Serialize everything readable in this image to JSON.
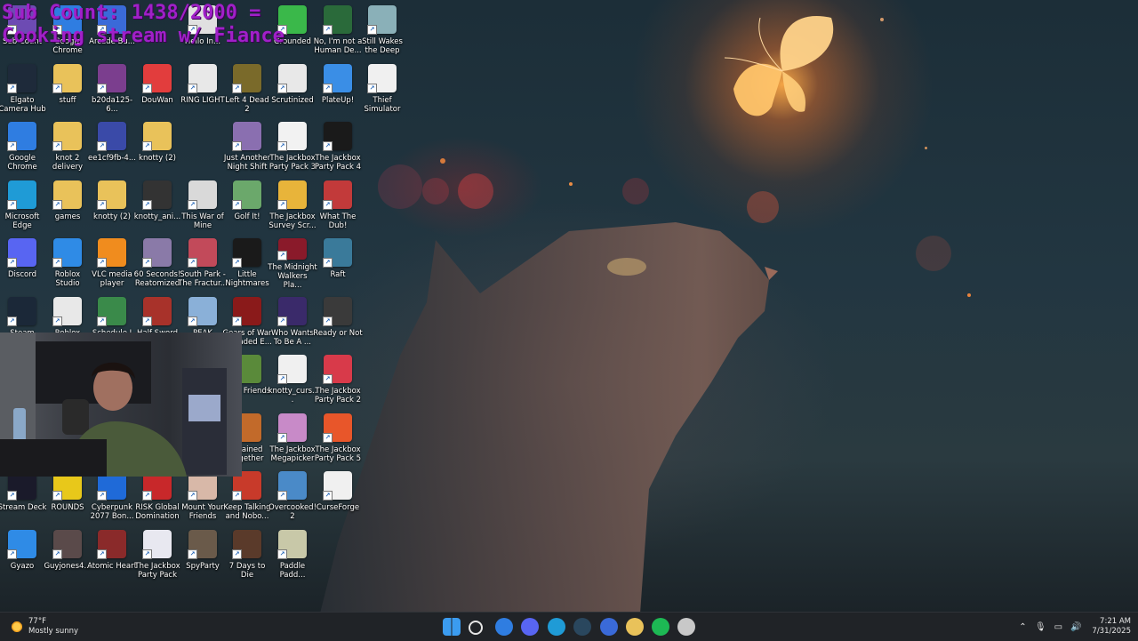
{
  "overlay": {
    "line1": "Sub Count: 1438/2000 =",
    "line2": "Cooking stream w/ Fiance",
    "color": "#a020c8"
  },
  "desktop_icons": [
    {
      "label": "Sub Count",
      "icon": "app-icon",
      "color": "#6d4bb3"
    },
    {
      "label": "Google Chrome",
      "icon": "chrome-icon",
      "color": "#2f7de1"
    },
    {
      "label": "Elgato Camera Hub",
      "icon": "camera-icon",
      "color": "#1e2a3a"
    },
    {
      "label": "stuff",
      "icon": "folder-icon",
      "color": "#e9c25a"
    },
    {
      "label": "b20da125-6...",
      "icon": "image-icon",
      "color": "#7b3e8e"
    },
    {
      "label": "DouWan",
      "icon": "douwan-icon",
      "color": "#e23d3d"
    },
    {
      "label": "RING LIGHT",
      "icon": "file-icon",
      "color": "#e8e8e8"
    },
    {
      "label": "Left 4 Dead 2",
      "icon": "game-icon",
      "color": "#7a6a2a"
    },
    {
      "label": "Scrutinized",
      "icon": "file-icon",
      "color": "#e8e8e8"
    },
    {
      "label": "PlateUp!",
      "icon": "game-icon",
      "color": "#3a8ee6"
    },
    {
      "label": "Thief Simulator",
      "icon": "game-icon",
      "color": "#f0f0f0"
    },
    {
      "label": "Google Chrome",
      "icon": "chrome-icon",
      "color": "#2f7de1"
    },
    {
      "label": "knot 2 delivery",
      "icon": "folder-icon",
      "color": "#e9c25a"
    },
    {
      "label": "ee1cf9fb-4...",
      "icon": "image-icon",
      "color": "#3a4aa8"
    },
    {
      "label": "knotty (2)",
      "icon": "folder-icon",
      "color": "#e9c25a"
    },
    {
      "label": "Just Another Night Shift",
      "icon": "game-icon",
      "color": "#8a6fb0"
    },
    {
      "label": "The Jackbox Party Pack 3",
      "icon": "jackbox-icon",
      "color": "#f2f2f2"
    },
    {
      "label": "The Jackbox Party Pack 4",
      "icon": "jackbox-icon",
      "color": "#1a1a1a"
    },
    {
      "label": "Microsoft Edge",
      "icon": "edge-icon",
      "color": "#1f9bd6"
    },
    {
      "label": "games",
      "icon": "folder-icon",
      "color": "#e9c25a"
    },
    {
      "label": "knotty (2)",
      "icon": "folder-icon",
      "color": "#e9c25a"
    },
    {
      "label": "knotty_ani...",
      "icon": "video-icon",
      "color": "#333333"
    },
    {
      "label": "This War of Mine",
      "icon": "game-icon",
      "color": "#d9d9d9"
    },
    {
      "label": "Golf It!",
      "icon": "game-icon",
      "color": "#6ba86b"
    },
    {
      "label": "The Jackbox Survey Scr...",
      "icon": "game-icon",
      "color": "#e8b43a"
    },
    {
      "label": "What The Dub!",
      "icon": "game-icon",
      "color": "#c23a3a"
    },
    {
      "label": "Discord",
      "icon": "discord-icon",
      "color": "#5865f2"
    },
    {
      "label": "Roblox Studio",
      "icon": "roblox-studio-icon",
      "color": "#2f8be6"
    },
    {
      "label": "VLC media player",
      "icon": "vlc-icon",
      "color": "#f08c1e"
    },
    {
      "label": "60 Seconds! Reatomized",
      "icon": "game-icon",
      "color": "#8a7aa8"
    },
    {
      "label": "South Park - The Fractur...",
      "icon": "game-icon",
      "color": "#c24a5a"
    },
    {
      "label": "Little Nightmares",
      "icon": "game-icon",
      "color": "#1a1a1a"
    },
    {
      "label": "The Midnight Walkers Pla...",
      "icon": "game-icon",
      "color": "#8a1a2a"
    },
    {
      "label": "Raft",
      "icon": "game-icon",
      "color": "#3a7a9a"
    },
    {
      "label": "Steam",
      "icon": "steam-icon",
      "color": "#1b2838"
    },
    {
      "label": "Roblox Player",
      "icon": "roblox-icon",
      "color": "#e8e8e8"
    },
    {
      "label": "Schedule I",
      "icon": "game-icon",
      "color": "#3a8a4a"
    },
    {
      "label": "Half Sword",
      "icon": "game-icon",
      "color": "#a8322a"
    },
    {
      "label": "PEAK",
      "icon": "game-icon",
      "color": "#8ab0d8"
    },
    {
      "label": "Gears of War Reloaded E...",
      "icon": "game-icon",
      "color": "#8a1a1a"
    },
    {
      "label": "Who Wants To Be A ...",
      "icon": "game-icon",
      "color": "#3a2a6a"
    },
    {
      "label": "Ready or Not",
      "icon": "game-icon",
      "color": "#3a3a3a"
    },
    {
      "label": "With Friends",
      "icon": "game-icon",
      "color": "#5a8a3a"
    },
    {
      "label": "knotty_curs...",
      "icon": "file-icon",
      "color": "#f0f0f0"
    },
    {
      "label": "The Jackbox Party Pack 2",
      "icon": "jackbox-icon",
      "color": "#d83a4a"
    },
    {
      "label": "Chained Together",
      "icon": "game-icon",
      "color": "#c26a2a"
    },
    {
      "label": "The Jackbox Megapicker",
      "icon": "jackbox-icon",
      "color": "#c88ac8"
    },
    {
      "label": "The Jackbox Party Pack 5",
      "icon": "jackbox-icon",
      "color": "#e8562a"
    },
    {
      "label": "Stream Deck",
      "icon": "stream-deck-icon",
      "color": "#1a1a2a"
    },
    {
      "label": "ROUNDS",
      "icon": "game-icon",
      "color": "#e8c81a"
    },
    {
      "label": "Cyberpunk 2077 Bon...",
      "icon": "music-icon",
      "color": "#1f6ad8"
    },
    {
      "label": "RISK Global Domination",
      "icon": "game-icon",
      "color": "#c8282a"
    },
    {
      "label": "Mount Your Friends",
      "icon": "game-icon",
      "color": "#d8b8a8"
    },
    {
      "label": "Keep Talking and Nobo...",
      "icon": "game-icon",
      "color": "#c83a2a"
    },
    {
      "label": "Overcooked! 2",
      "icon": "game-icon",
      "color": "#4a8ac8"
    },
    {
      "label": "CurseForge",
      "icon": "curseforge-icon",
      "color": "#f0f0f0"
    },
    {
      "label": "Gyazo",
      "icon": "gyazo-icon",
      "color": "#2f8be6"
    },
    {
      "label": "Guyjones4...",
      "icon": "image-icon",
      "color": "#5a4a4a"
    },
    {
      "label": "Atomic Heart",
      "icon": "game-icon",
      "color": "#8a2a2a"
    },
    {
      "label": "The Jackbox Party Pack",
      "icon": "jackbox-icon",
      "color": "#e8e8f0"
    },
    {
      "label": "SpyParty",
      "icon": "game-icon",
      "color": "#6a5a4a"
    },
    {
      "label": "7 Days to Die",
      "icon": "game-icon",
      "color": "#5a3a2a"
    },
    {
      "label": "Paddle Padd...",
      "icon": "game-icon",
      "color": "#c8c8a8"
    },
    {
      "label": "Arcade Bu...",
      "icon": "app-icon",
      "color": "#3a6ad8"
    },
    {
      "label": "Hello In...",
      "icon": "file-icon",
      "color": "#e0e0e0"
    },
    {
      "label": "Grounded",
      "icon": "game-icon",
      "color": "#3ab84a"
    },
    {
      "label": "No, I'm not a Human De...",
      "icon": "game-icon",
      "color": "#2a6a3a"
    },
    {
      "label": "Still Wakes the Deep",
      "icon": "game-icon",
      "color": "#8ab0b8"
    }
  ],
  "taskbar": {
    "weather_temp": "77°F",
    "weather_desc": "Mostly sunny",
    "pinned": [
      {
        "name": "windows-start-icon",
        "color": "#3b9cf0"
      },
      {
        "name": "search-icon",
        "color": "#e6e6e6"
      },
      {
        "name": "chrome-icon",
        "color": "#2f7de1"
      },
      {
        "name": "discord-icon",
        "color": "#5865f2"
      },
      {
        "name": "edge-icon",
        "color": "#1f9bd6"
      },
      {
        "name": "steam-icon",
        "color": "#2a475e"
      },
      {
        "name": "app-store-icon",
        "color": "#3a6ad8"
      },
      {
        "name": "file-explorer-icon",
        "color": "#e9c25a"
      },
      {
        "name": "spotify-icon",
        "color": "#1db954"
      },
      {
        "name": "clock-app-icon",
        "color": "#c8c8c8"
      }
    ],
    "time": "7:21 AM",
    "date": "7/31/2025"
  }
}
